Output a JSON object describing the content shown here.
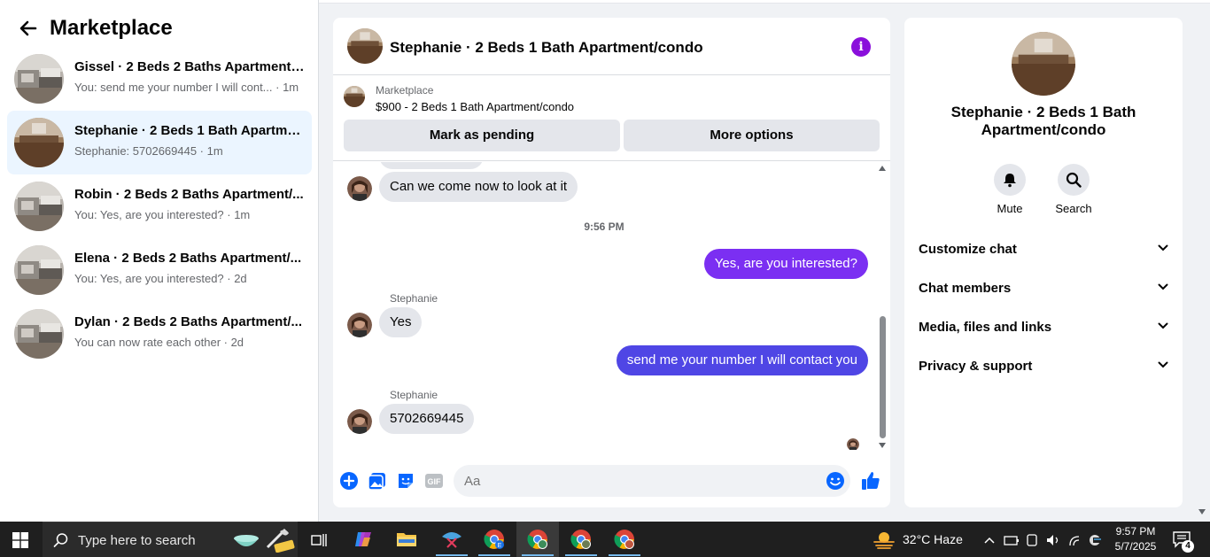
{
  "sidebar": {
    "title": "Marketplace",
    "conversations": [
      {
        "title": "Gissel · 2 Beds 2 Baths Apartment/...",
        "preview": "You: send me your number I will cont... · 1m"
      },
      {
        "title": "Stephanie · 2 Beds 1 Bath Apartme...",
        "preview": "Stephanie: 5702669445 · 1m",
        "active": true
      },
      {
        "title": "Robin · 2 Beds 2 Baths Apartment/...",
        "preview": "You: Yes, are you interested? · 1m"
      },
      {
        "title": "Elena · 2 Beds 2 Baths Apartment/...",
        "preview": "You: Yes, are you interested? · 2d"
      },
      {
        "title": "Dylan · 2 Beds 2 Baths Apartment/...",
        "preview": "You can now rate each other · 2d"
      }
    ]
  },
  "chat": {
    "title": "Stephanie · 2 Beds 1 Bath Apartment/condo",
    "info_icon": "i",
    "listing": {
      "label": "Marketplace",
      "price_title": "$900 - 2 Beds 1 Bath Apartment/condo",
      "pending_button": "Mark as pending",
      "more_button": "More options"
    },
    "messages": {
      "m1": "Can we come now to look at it",
      "timestamp": "9:56 PM",
      "m2": "Yes, are you interested?",
      "sender1": "Stephanie",
      "m3": "Yes",
      "m4": "send me your number I will contact you",
      "sender2": "Stephanie",
      "m5": "5702669445"
    },
    "composer": {
      "placeholder": "Aa",
      "gif_label": "GIF"
    }
  },
  "details": {
    "title": "Stephanie · 2 Beds 1 Bath Apartment/condo",
    "mute_label": "Mute",
    "search_label": "Search",
    "sections": [
      "Customize chat",
      "Chat members",
      "Media, files and links",
      "Privacy & support"
    ]
  },
  "taskbar": {
    "search_placeholder": "Type here to search",
    "weather": "32°C  Haze",
    "time": "9:57 PM",
    "date": "5/7/2025",
    "notification_count": "4"
  },
  "colors": {
    "accent_purple": "#8a0fdb",
    "bubble_out_1": "#7b2ff2",
    "bubble_out_2": "#4f46e5",
    "active_conv": "#ebf5ff",
    "like_blue": "#0866ff"
  }
}
